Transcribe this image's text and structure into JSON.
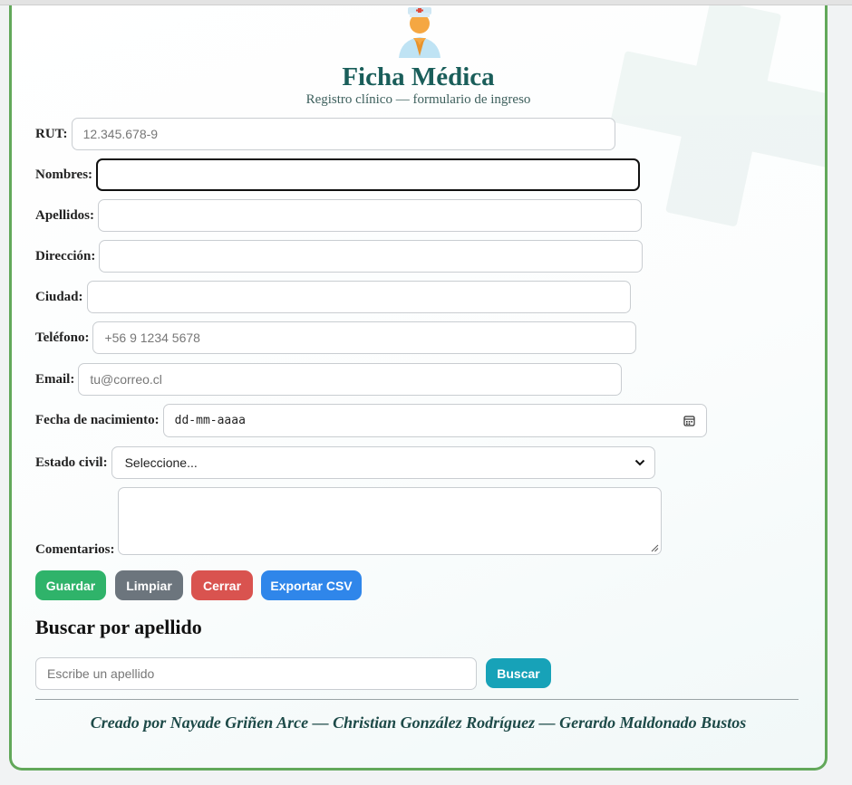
{
  "header": {
    "title": "Ficha Médica",
    "subtitle": "Registro clínico — formulario de ingreso",
    "doctor_icon": "doctor-avatar-icon",
    "bg_icon": "medical-cross-icon"
  },
  "form": {
    "rut": {
      "label": "RUT:",
      "placeholder": "12.345.678-9",
      "value": ""
    },
    "nombres": {
      "label": "Nombres:",
      "placeholder": "",
      "value": ""
    },
    "apellidos": {
      "label": "Apellidos:",
      "placeholder": "",
      "value": ""
    },
    "direccion": {
      "label": "Dirección:",
      "placeholder": "",
      "value": ""
    },
    "ciudad": {
      "label": "Ciudad:",
      "placeholder": "",
      "value": ""
    },
    "telefono": {
      "label": "Teléfono:",
      "placeholder": "+56 9 1234 5678",
      "value": ""
    },
    "email": {
      "label": "Email:",
      "placeholder": "tu@correo.cl",
      "value": ""
    },
    "fecha": {
      "label": "Fecha de nacimiento:",
      "value": "dd-mm-aaaa"
    },
    "estado_civil": {
      "label": "Estado civil:",
      "selected": "Seleccione..."
    },
    "comentarios": {
      "label": "Comentarios:",
      "value": ""
    }
  },
  "buttons": {
    "guardar": "Guardar",
    "limpiar": "Limpiar",
    "cerrar": "Cerrar",
    "exportar": "Exportar CSV"
  },
  "search": {
    "heading": "Buscar por apellido",
    "placeholder": "Escribe un apellido",
    "button": "Buscar"
  },
  "footer": {
    "credits": "Creado por Nayade Griñen Arce — Christian González Rodríguez — Gerardo Maldonado Bustos"
  },
  "colors": {
    "accent_green": "#62a85a",
    "title_teal": "#1a5e5a",
    "guardar": "#2fb36a",
    "limpiar": "#6c757d",
    "cerrar": "#d9534f",
    "exportar": "#2f86ea",
    "buscar": "#17a2b8"
  }
}
